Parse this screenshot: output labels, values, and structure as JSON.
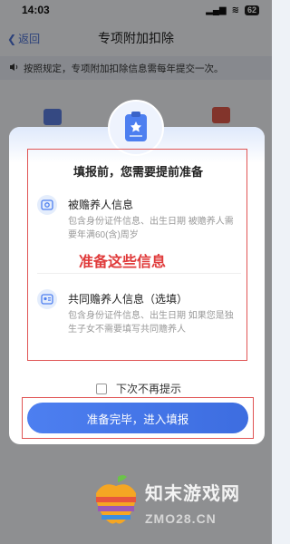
{
  "status_bar": {
    "time": "14:03",
    "signal": "▂▄▆",
    "wifi": "≋",
    "battery": "62"
  },
  "nav": {
    "back_label": "返回",
    "title": "专项附加扣除"
  },
  "notice": {
    "text": "按照规定，专项附加扣除信息需每年提交一次。"
  },
  "dialog": {
    "heading": "填报前，您需要提前准备",
    "items": [
      {
        "title": "被赡养人信息",
        "desc": "包含身份证件信息、出生日期 被赡养人需要年满60(含)周岁",
        "icon": "id-card-icon"
      },
      {
        "title": "共同赡养人信息（选填）",
        "desc": "包含身份证件信息、出生日期 如果您是独生子女不需要填写共同赡养人",
        "icon": "contact-card-icon"
      }
    ],
    "annotation": "准备这些信息",
    "checkbox_label": "下次不再提示",
    "confirm_label": "准备完毕，进入填报"
  },
  "watermark": {
    "name": "知末游戏网",
    "url": "ZMO28.CN"
  },
  "colors": {
    "accent": "#4d7ff0",
    "annotation_red": "#e03b3b"
  }
}
